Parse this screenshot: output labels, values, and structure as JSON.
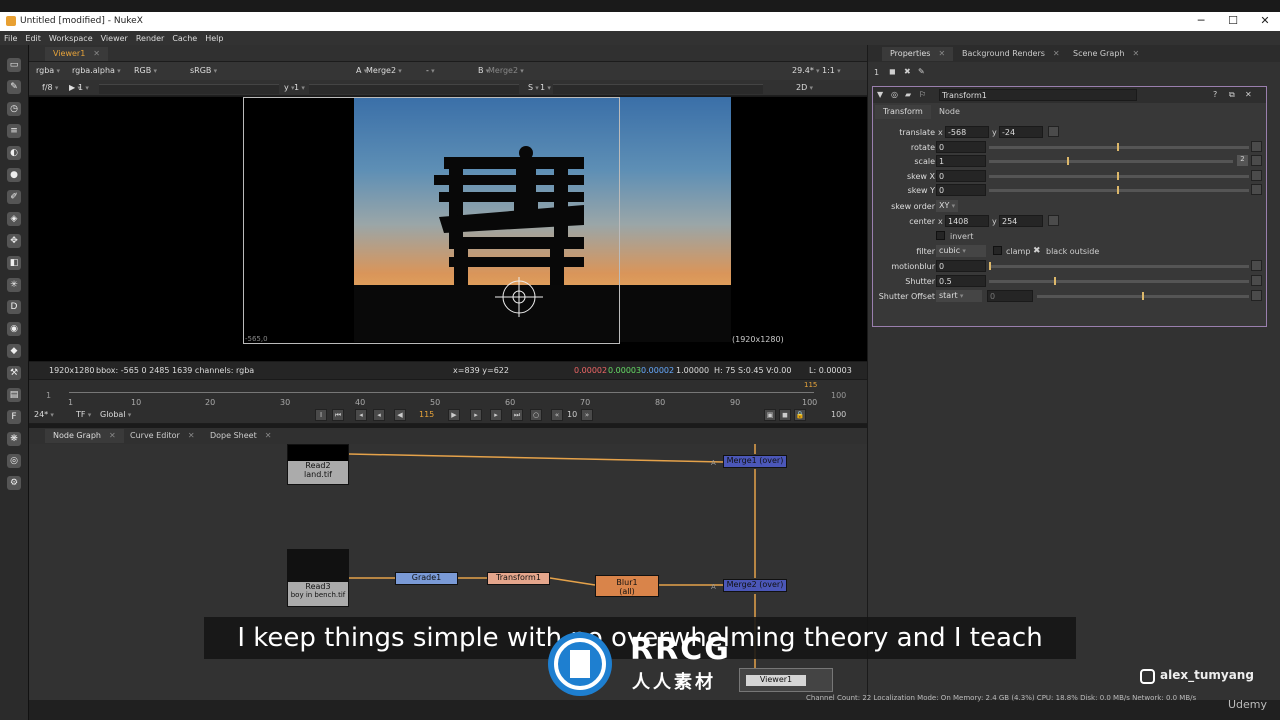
{
  "window": {
    "title": "Untitled [modified] - NukeX",
    "minimize": "─",
    "maximize": "☐",
    "close": "✕"
  },
  "watermark": {
    "top": "RRCG.cn",
    "logo_text": "RRCG",
    "logo_sub": "人人素材"
  },
  "menu": [
    "File",
    "Edit",
    "Workspace",
    "Viewer",
    "Render",
    "Cache",
    "Help"
  ],
  "viewer": {
    "tab": "Viewer1",
    "channels": "rgba",
    "alpha": "rgba.alpha",
    "display": "RGB",
    "lut": "sRGB",
    "input_a_label": "A",
    "input_a": "Merge2",
    "input_mid": "-",
    "input_b_label": "B",
    "input_b": "Merge2",
    "zoom": "29.4*",
    "ratio": "1:1",
    "fstop": "f/8",
    "frame_field": "1",
    "y_label": "y",
    "y_value": "1",
    "s_label": "S",
    "s_value": "1",
    "view_mode": "2D",
    "format_label": "(1920x1280)",
    "bbox_corner": "-565,0",
    "status": {
      "res": "1920x1280",
      "bbox": "bbox: -565 0 2485 1639 channels: rgba",
      "coords": "x=839 y=622",
      "r": "0.00002",
      "g": "0.00003",
      "b": "0.00002",
      "a": "1.00000",
      "hsv": "H: 75 S:0.45 V:0.00",
      "l": "L: 0.00003"
    }
  },
  "timeline": {
    "ticks": [
      "1",
      "10",
      "20",
      "30",
      "40",
      "50",
      "60",
      "70",
      "80",
      "90",
      "100"
    ],
    "start": "1",
    "end": "100",
    "current_marker": "115",
    "fps": "24*",
    "tf": "TF",
    "scope": "Global",
    "current_frame": "115",
    "step": "10",
    "end_field": "100"
  },
  "nodegraph_tabs": [
    "Node Graph",
    "Curve Editor",
    "Dope Sheet"
  ],
  "nodes": {
    "read2": {
      "name": "Read2",
      "file": "land.tif"
    },
    "read3": {
      "name": "Read3",
      "file": "boy in bench.tif"
    },
    "grade": "Grade1",
    "transform": "Transform1",
    "blur": "Blur1",
    "blur_sub": "(all)",
    "merge1": "Merge1 (over)",
    "merge2": "Merge2 (over)",
    "viewer": "Viewer1",
    "input_a": "A"
  },
  "properties": {
    "tabs": [
      "Properties",
      "Background Renders",
      "Scene Graph"
    ],
    "count": "1",
    "node_name": "Transform1",
    "subtabs": [
      "Transform",
      "Node"
    ],
    "rows": [
      {
        "label": "translate",
        "x_label": "x",
        "x": "-568",
        "y_label": "y",
        "y": "-24"
      },
      {
        "label": "rotate",
        "value": "0"
      },
      {
        "label": "scale",
        "value": "1",
        "badge": "2"
      },
      {
        "label": "skew X",
        "value": "0"
      },
      {
        "label": "skew Y",
        "value": "0"
      },
      {
        "label": "skew order",
        "value": "XY"
      },
      {
        "label": "center",
        "x_label": "x",
        "x": "1408",
        "y_label": "y",
        "y": "254"
      },
      {
        "label": "invert"
      },
      {
        "label": "filter",
        "value": "cubic",
        "clamp": "clamp",
        "black_outside": "black outside",
        "check": "✖"
      },
      {
        "label": "motionblur",
        "value": "0"
      },
      {
        "label": "Shutter",
        "value": "0.5"
      },
      {
        "label": "Shutter Offset",
        "value": "start",
        "extra": "0"
      }
    ]
  },
  "bottom_status": "Channel Count: 22  Localization Mode: On  Memory: 2.4 GB (4.3%)  CPU: 18.8%  Disk: 0.0 MB/s  Network: 0.0 MB/s",
  "subtitle": "I keep things simple with no overwhelming theory and I teach",
  "instagram": "alex_tumyang",
  "udemy": "Udemy"
}
